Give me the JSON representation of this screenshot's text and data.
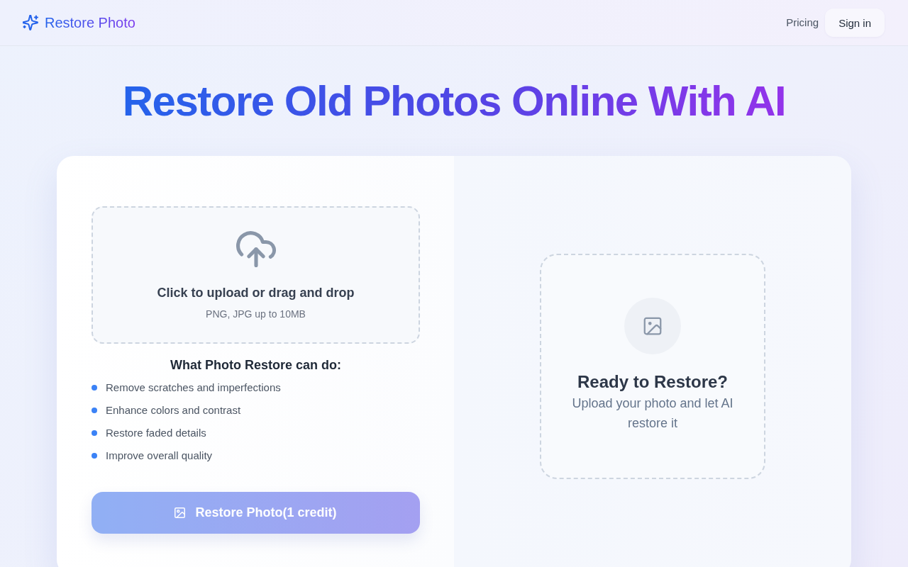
{
  "header": {
    "logo": "Restore Photo",
    "nav": [
      {
        "kind": "link",
        "label": "Pricing"
      },
      {
        "kind": "button",
        "label": "Sign in"
      }
    ]
  },
  "headline": "Restore Old Photos Online With AI",
  "upload": {
    "title": "Click to upload or drag and drop",
    "hint": "PNG, JPG up to 10MB"
  },
  "features": {
    "title": "What Photo Restore can do:",
    "items": [
      "Remove scratches and imperfections",
      "Enhance colors and contrast",
      "Restore faded details",
      "Improve overall quality"
    ]
  },
  "restore_button": {
    "label": "Restore Photo(1 credit)",
    "disabled": true
  },
  "preview": {
    "title": "Ready to Restore?",
    "text": "Upload your photo and let AI restore it"
  }
}
